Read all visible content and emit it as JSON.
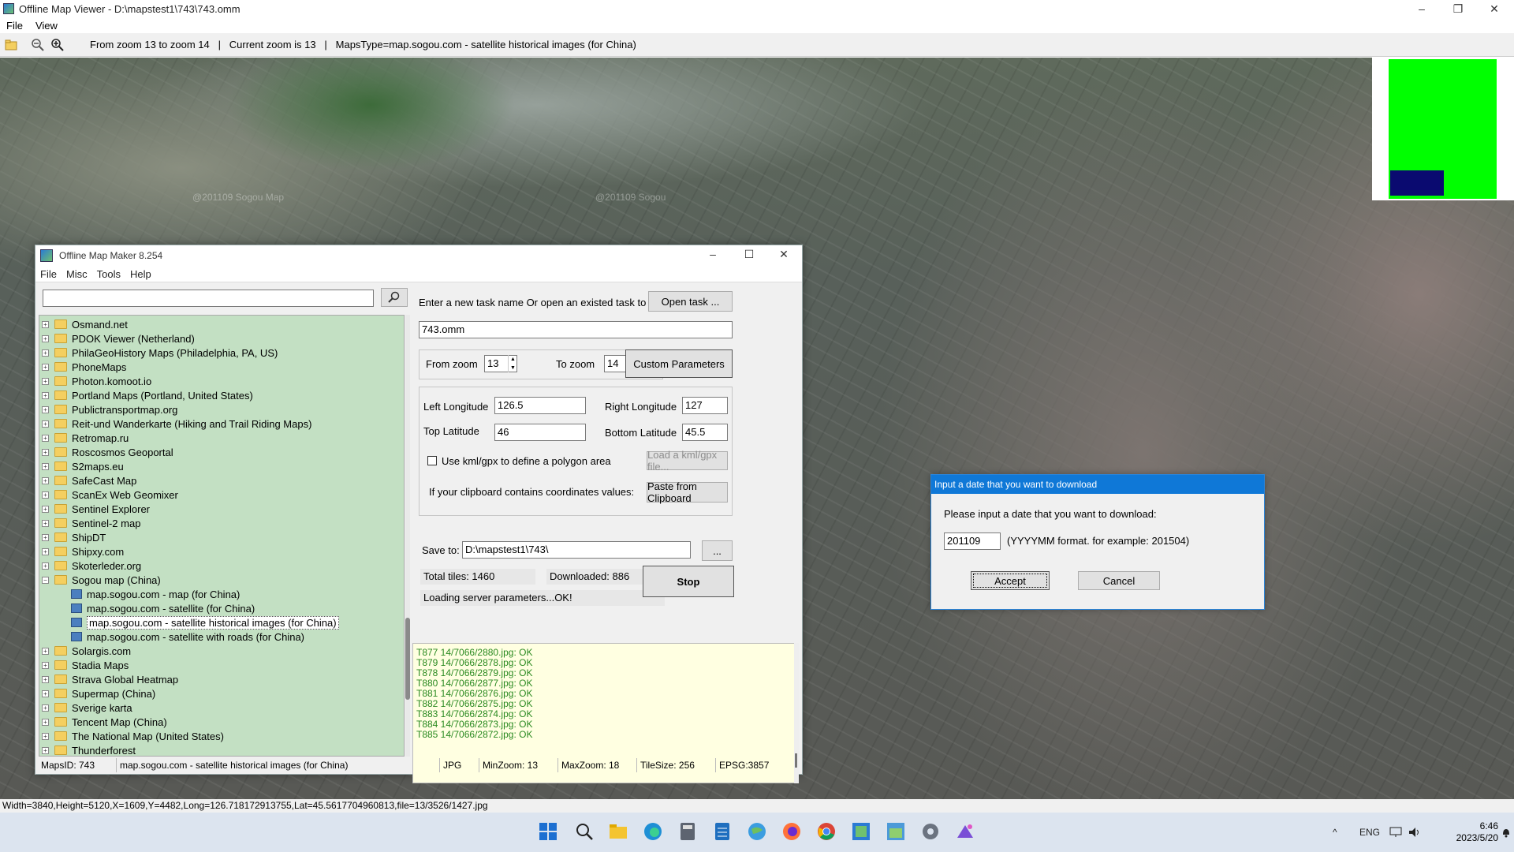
{
  "viewer": {
    "title": "Offline Map Viewer - D:\\mapstest1\\743\\743.omm",
    "menu": [
      "File",
      "View"
    ],
    "toolbar_info": "From zoom 13 to zoom 14   |   Current zoom is 13   |   MapsType=map.sogou.com - satellite historical images (for China)",
    "watermarks": [
      "@201109 Sogou Map",
      "@201109 Sogou"
    ],
    "status": "Width=3840,Height=5120,X=1609,Y=4482,Long=126.718172913755,Lat=45.5617704960813,file=13/3526/1427.jpg",
    "minimap_colors": {
      "area": "#00ff00",
      "viewport": "#0a0a70"
    }
  },
  "maker": {
    "title": "Offline Map Maker 8.254",
    "menu": [
      "File",
      "Misc",
      "Tools",
      "Help"
    ],
    "search_value": "",
    "tree": [
      {
        "label": "Osmand.net",
        "type": "folder"
      },
      {
        "label": "PDOK Viewer (Netherland)",
        "type": "folder"
      },
      {
        "label": "PhilaGeoHistory Maps (Philadelphia, PA, US)",
        "type": "folder"
      },
      {
        "label": "PhoneMaps",
        "type": "folder"
      },
      {
        "label": "Photon.komoot.io",
        "type": "folder"
      },
      {
        "label": "Portland Maps (Portland, United States)",
        "type": "folder"
      },
      {
        "label": "Publictransportmap.org",
        "type": "folder"
      },
      {
        "label": "Reit-und Wanderkarte (Hiking and Trail Riding Maps)",
        "type": "folder"
      },
      {
        "label": "Retromap.ru",
        "type": "folder"
      },
      {
        "label": "Roscosmos Geoportal",
        "type": "folder"
      },
      {
        "label": "S2maps.eu",
        "type": "folder"
      },
      {
        "label": "SafeCast Map",
        "type": "folder"
      },
      {
        "label": "ScanEx Web Geomixer",
        "type": "folder"
      },
      {
        "label": "Sentinel Explorer",
        "type": "folder"
      },
      {
        "label": "Sentinel-2 map",
        "type": "folder"
      },
      {
        "label": "ShipDT",
        "type": "folder"
      },
      {
        "label": "Shipxy.com",
        "type": "folder"
      },
      {
        "label": "Skoterleder.org",
        "type": "folder"
      },
      {
        "label": "Sogou map (China)",
        "type": "folder-open"
      },
      {
        "label": "map.sogou.com - map (for China)",
        "type": "leaf"
      },
      {
        "label": "map.sogou.com - satellite (for China)",
        "type": "leaf"
      },
      {
        "label": "map.sogou.com - satellite historical images (for China)",
        "type": "leaf-selected"
      },
      {
        "label": "map.sogou.com - satellite with roads (for China)",
        "type": "leaf"
      },
      {
        "label": "Solargis.com",
        "type": "folder"
      },
      {
        "label": "Stadia Maps",
        "type": "folder"
      },
      {
        "label": "Strava Global Heatmap",
        "type": "folder"
      },
      {
        "label": "Supermap (China)",
        "type": "folder"
      },
      {
        "label": "Sverige karta",
        "type": "folder"
      },
      {
        "label": "Tencent Map (China)",
        "type": "folder"
      },
      {
        "label": "The National Map (United States)",
        "type": "folder"
      },
      {
        "label": "Thunderforest",
        "type": "folder"
      }
    ],
    "task_prompt": "Enter a new task name Or open an existed task to continue:",
    "open_task_label": "Open task ...",
    "task_name": "743.omm",
    "from_zoom_label": "From zoom",
    "from_zoom": "13",
    "to_zoom_label": "To zoom",
    "to_zoom": "14",
    "custom_params_label": "Custom Parameters",
    "left_lon_label": "Left Longitude",
    "left_lon": "126.5",
    "right_lon_label": "Right Longitude",
    "right_lon": "127",
    "top_lat_label": "Top Latitude",
    "top_lat": "46",
    "bottom_lat_label": "Bottom Latitude",
    "bottom_lat": "45.5",
    "kml_checkbox_label": "Use kml/gpx to define a polygon area",
    "kml_checked": false,
    "load_kml_label": "Load a kml/gpx file...",
    "clipboard_prompt": "If your clipboard contains coordinates values:",
    "paste_label": "Paste from Clipboard",
    "save_to_label": "Save to:",
    "save_to": "D:\\mapstest1\\743\\",
    "browse_label": "...",
    "total_tiles": "Total tiles: 1460",
    "downloaded": "Downloaded: 886",
    "server_status": "Loading server parameters...OK!",
    "stop_label": "Stop",
    "log": [
      "T877 14/7066/2880.jpg: OK",
      "T879 14/7066/2878.jpg: OK",
      "T878 14/7066/2879.jpg: OK",
      "T880 14/7066/2877.jpg: OK",
      "T881 14/7066/2876.jpg: OK",
      "T882 14/7066/2875.jpg: OK",
      "T883 14/7066/2874.jpg: OK",
      "T884 14/7066/2873.jpg: OK",
      "T885 14/7066/2872.jpg: OK"
    ],
    "status_cells": [
      "MapsID: 743",
      "map.sogou.com - satellite historical images (for China)",
      "JPG",
      "MinZoom: 13",
      "MaxZoom: 18",
      "TileSize: 256",
      "EPSG:3857"
    ]
  },
  "dialog": {
    "title": "Input a date that you want to download",
    "prompt": "Please input a date that you want to download:",
    "value": "201109",
    "hint": "(YYYYMM format.   for example: 201504)",
    "accept_label": "Accept",
    "cancel_label": "Cancel"
  },
  "taskbar": {
    "apps": [
      "start-icon",
      "search-icon",
      "file-explorer-icon",
      "edge-icon",
      "calculator-icon",
      "notepad-icon",
      "globe-icon",
      "firefox-icon",
      "chrome-icon",
      "map-viewer-icon",
      "map-maker-icon",
      "settings-icon",
      "paint-icon"
    ],
    "lang": "ENG",
    "time": "6:46",
    "date": "2023/5/20"
  }
}
